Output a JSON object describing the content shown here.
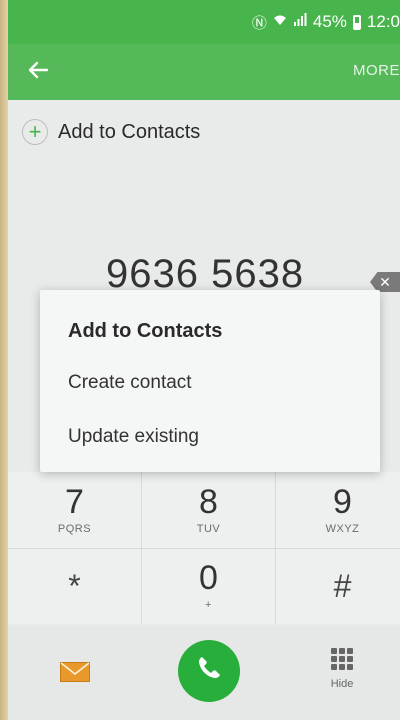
{
  "status_bar": {
    "battery_percent": "45%",
    "time": "12:0",
    "icons": [
      "nfc-icon",
      "wifi-icon",
      "signal-icon",
      "battery-icon"
    ]
  },
  "app_bar": {
    "back_icon": "arrow-left-icon",
    "more_label": "MORE"
  },
  "add_contacts_row": {
    "label": "Add to Contacts",
    "icon": "plus-icon"
  },
  "dialed_number": "9636 5638",
  "dialog": {
    "title": "Add to Contacts",
    "items": [
      "Create contact",
      "Update existing"
    ]
  },
  "keypad": {
    "keys": [
      {
        "digit": "7",
        "letters": "PQRS"
      },
      {
        "digit": "8",
        "letters": "TUV"
      },
      {
        "digit": "9",
        "letters": "WXYZ"
      },
      {
        "digit": "*",
        "letters": ""
      },
      {
        "digit": "0",
        "letters": "+"
      },
      {
        "digit": "#",
        "letters": ""
      }
    ]
  },
  "bottom_bar": {
    "message_icon": "envelope-icon",
    "call_icon": "phone-icon",
    "hide_label": "Hide"
  },
  "colors": {
    "status_green": "#47b44c",
    "appbar_green": "#55b859",
    "call_green": "#27ae3b",
    "envelope_orange": "#e79a2b"
  }
}
